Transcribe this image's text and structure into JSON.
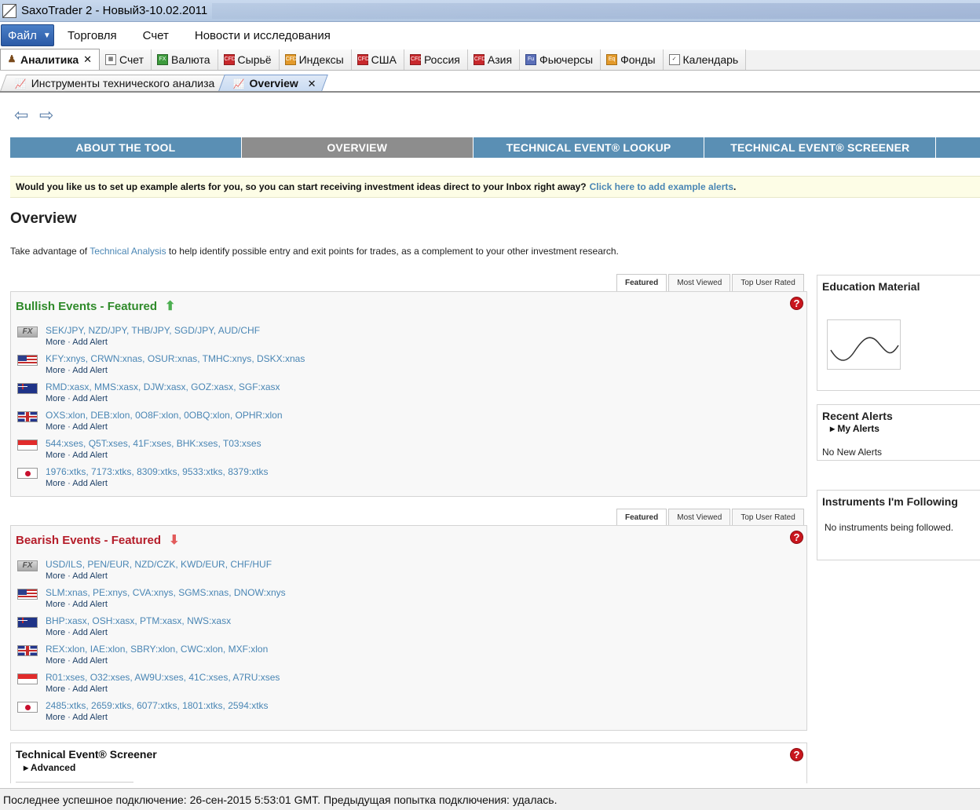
{
  "window": {
    "title": "SaxoTrader 2 - Новый3-10.02.2011"
  },
  "menu": {
    "file": "Файл",
    "items": [
      "Торговля",
      "Счет",
      "Новости и исследования"
    ]
  },
  "main_tabs": [
    {
      "label": "Аналитика",
      "icon": "person-icon"
    },
    {
      "label": "Счет",
      "icon": "table-icon"
    },
    {
      "label": "Валюта",
      "icon": "fx-icon"
    },
    {
      "label": "Сырьё",
      "icon": "cfd-icon"
    },
    {
      "label": "Индексы",
      "icon": "cfd-icon"
    },
    {
      "label": "США",
      "icon": "cfd-icon"
    },
    {
      "label": "Россия",
      "icon": "cfd-icon"
    },
    {
      "label": "Азия",
      "icon": "cfd-icon"
    },
    {
      "label": "Фьючерсы",
      "icon": "futures-icon"
    },
    {
      "label": "Фонды",
      "icon": "funds-icon"
    },
    {
      "label": "Календарь",
      "icon": "calendar-icon"
    }
  ],
  "sub_tabs": [
    {
      "label": "Инструменты технического анализа"
    },
    {
      "label": "Overview"
    }
  ],
  "tool_nav": [
    "ABOUT THE TOOL",
    "OVERVIEW",
    "TECHNICAL EVENT® LOOKUP",
    "TECHNICAL EVENT® SCREENER"
  ],
  "notice": {
    "text": "Would you like us to set up example alerts for you, so you can start receiving investment ideas direct to your Inbox right away?",
    "link": "Click here to add example alerts",
    "end": "."
  },
  "overview": {
    "title": "Overview",
    "intro_pre": "Take advantage of ",
    "intro_link": "Technical Analysis",
    "intro_post": " to help identify possible entry and exit points for trades, as a complement to your other investment research."
  },
  "panel_tabs": [
    "Featured",
    "Most Viewed",
    "Top User Rated"
  ],
  "actions": {
    "more": "More",
    "dot": " · ",
    "add": "Add Alert"
  },
  "bullish": {
    "title": "Bullish Events - Featured",
    "rows": [
      {
        "flag": "fx",
        "symbols": [
          "SEK/JPY",
          "NZD/JPY",
          "THB/JPY",
          "SGD/JPY",
          "AUD/CHF"
        ]
      },
      {
        "flag": "us",
        "symbols": [
          "KFY:xnys",
          "CRWN:xnas",
          "OSUR:xnas",
          "TMHC:xnys",
          "DSKX:xnas"
        ]
      },
      {
        "flag": "au",
        "symbols": [
          "RMD:xasx",
          "MMS:xasx",
          "DJW:xasx",
          "GOZ:xasx",
          "SGF:xasx"
        ]
      },
      {
        "flag": "uk",
        "symbols": [
          "OXS:xlon",
          "DEB:xlon",
          "0O8F:xlon",
          "0OBQ:xlon",
          "OPHR:xlon"
        ]
      },
      {
        "flag": "sg",
        "symbols": [
          "544:xses",
          "Q5T:xses",
          "41F:xses",
          "BHK:xses",
          "T03:xses"
        ]
      },
      {
        "flag": "jp",
        "symbols": [
          "1976:xtks",
          "7173:xtks",
          "8309:xtks",
          "9533:xtks",
          "8379:xtks"
        ]
      }
    ]
  },
  "bearish": {
    "title": "Bearish Events - Featured",
    "rows": [
      {
        "flag": "fx",
        "symbols": [
          "USD/ILS",
          "PEN/EUR",
          "NZD/CZK",
          "KWD/EUR",
          "CHF/HUF"
        ]
      },
      {
        "flag": "us",
        "symbols": [
          "SLM:xnas",
          "PE:xnys",
          "CVA:xnys",
          "SGMS:xnas",
          "DNOW:xnys"
        ]
      },
      {
        "flag": "au",
        "symbols": [
          "BHP:xasx",
          "OSH:xasx",
          "PTM:xasx",
          "NWS:xasx"
        ]
      },
      {
        "flag": "uk",
        "symbols": [
          "REX:xlon",
          "IAE:xlon",
          "SBRY:xlon",
          "CWC:xlon",
          "MXF:xlon"
        ]
      },
      {
        "flag": "sg",
        "symbols": [
          "R01:xses",
          "O32:xses",
          "AW9U:xses",
          "41C:xses",
          "A7RU:xses"
        ]
      },
      {
        "flag": "jp",
        "symbols": [
          "2485:xtks",
          "2659:xtks",
          "6077:xtks",
          "1801:xtks",
          "2594:xtks"
        ]
      }
    ]
  },
  "screener": {
    "title": "Technical Event® Screener",
    "advanced": "Advanced"
  },
  "sidebar": {
    "education_title": "Education Material",
    "alerts_title": "Recent Alerts",
    "my_alerts": "My Alerts",
    "no_alerts": "No New Alerts",
    "following_title": "Instruments I'm Following",
    "no_following": "No instruments being followed."
  },
  "status": {
    "text": "Последнее успешное подключение: 26-сен-2015 5:53:01 GMT. Предыдущая попытка подключения: удалась."
  }
}
